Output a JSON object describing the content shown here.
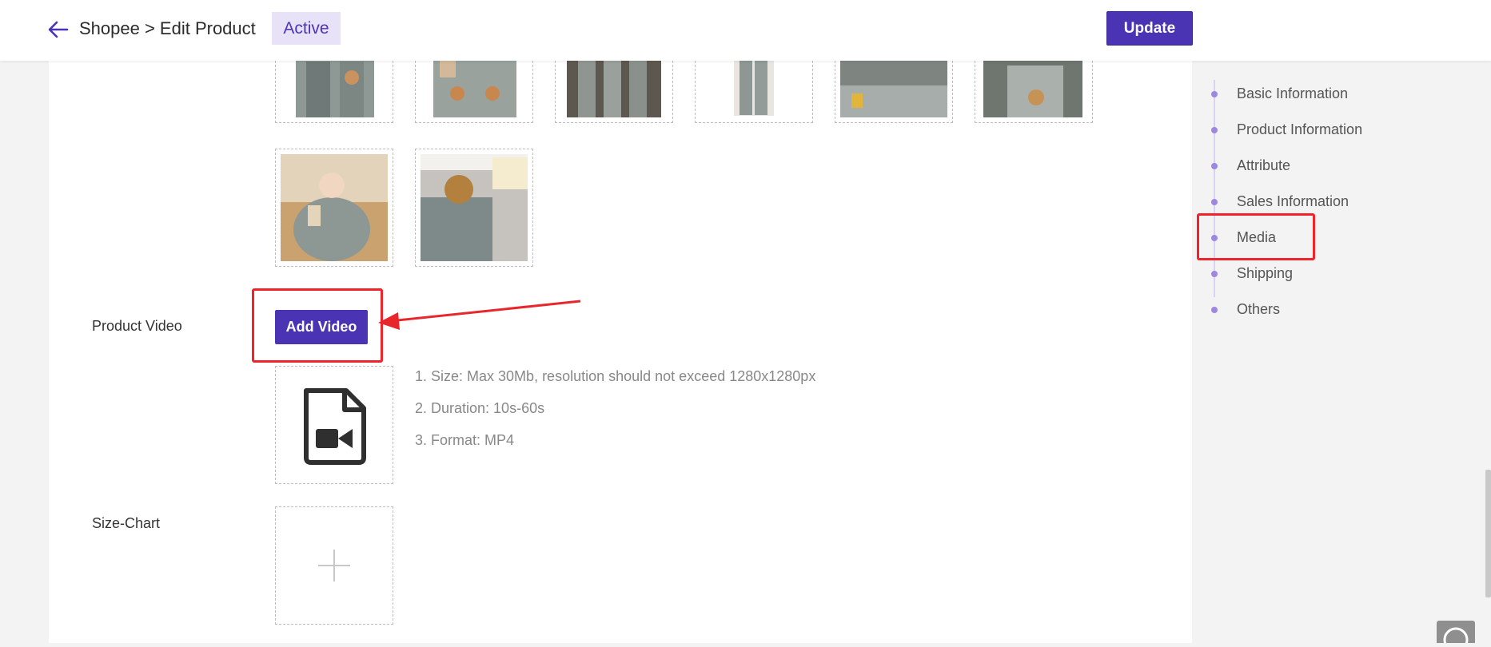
{
  "header": {
    "breadcrumb": "Shopee > Edit Product",
    "status": "Active",
    "update_label": "Update"
  },
  "media": {
    "product_video": {
      "label": "Product Video",
      "button": "Add Video",
      "hints": [
        "1. Size: Max 30Mb, resolution should not exceed 1280x1280px",
        "2. Duration: 10s-60s",
        "3. Format: MP4"
      ]
    },
    "size_chart": {
      "label": "Size-Chart"
    }
  },
  "sidebar": {
    "items": [
      {
        "label": "Basic Information"
      },
      {
        "label": "Product Information"
      },
      {
        "label": "Attribute"
      },
      {
        "label": "Sales Information"
      },
      {
        "label": "Media"
      },
      {
        "label": "Shipping"
      },
      {
        "label": "Others"
      }
    ]
  },
  "colors": {
    "accent": "#4a34b3",
    "badge_bg": "#e7e2f8",
    "highlight": "#f0232b",
    "nav_dot": "#9d87e0"
  },
  "icons": [
    "back-arrow-icon",
    "video-file-icon",
    "plus-icon",
    "customer-support-icon"
  ]
}
